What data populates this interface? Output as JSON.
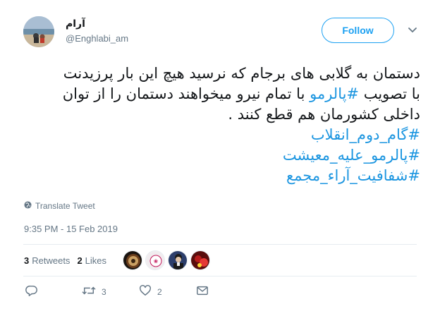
{
  "user": {
    "display_name": "آرام",
    "handle": "@Enghlabi_am",
    "avatar_icon": "beach-photo-avatar"
  },
  "follow_button": {
    "label": "Follow"
  },
  "more_menu": {
    "icon": "chevron-down-icon"
  },
  "tweet": {
    "lines": [
      {
        "text": "دستمان به گلابی های برجام که نرسید هیچ این بار پرزیدنت"
      },
      {
        "prefix": "با تصویب ",
        "hashtag": "#پالرمو",
        "suffix": " با تمام نیرو میخواهند دستمان را از توان"
      },
      {
        "text": "داخلی کشورمان هم قطع کنند ."
      }
    ],
    "hashtags": [
      "#گام_دوم_انقلاب",
      "#پالرمو_علیه_معیشت",
      "#شفافیت_آراء_مجمع"
    ]
  },
  "translate": {
    "label": "Translate Tweet",
    "icon": "globe-icon"
  },
  "timestamp": "9:35 PM - 15 Feb 2019",
  "stats": {
    "retweets_count": "3",
    "retweets_label": "Retweets",
    "likes_count": "2",
    "likes_label": "Likes"
  },
  "liker_avatars": [
    "seal-avatar",
    "sticker-avatar",
    "cleric-avatar",
    "red-photo-avatar"
  ],
  "actions": {
    "reply_icon": "reply-icon",
    "retweet_icon": "retweet-icon",
    "retweet_count": "3",
    "like_icon": "heart-icon",
    "like_count": "2",
    "dm_icon": "envelope-icon"
  },
  "colors": {
    "accent": "#1da1f2",
    "hashtag": "#1b95e0",
    "secondary_text": "#657786",
    "divider": "#e6ecf0"
  }
}
